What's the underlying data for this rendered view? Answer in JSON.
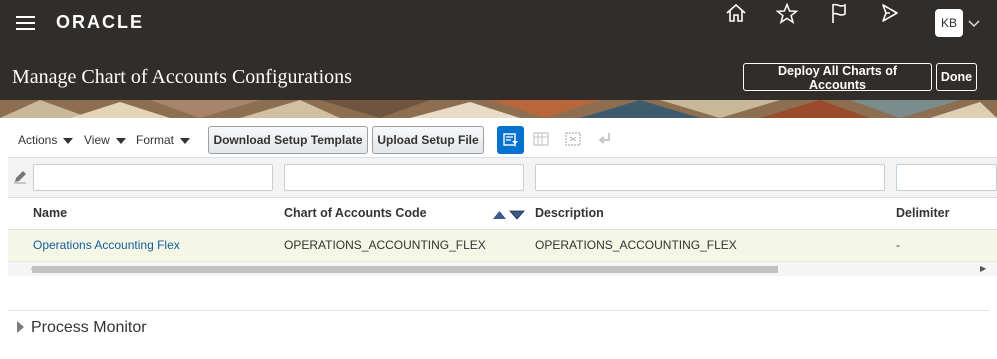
{
  "header": {
    "logo_text": "ORACLE",
    "icons": [
      "home-icon",
      "star-icon",
      "flag-icon",
      "notifications-icon"
    ],
    "user_initials": "KB"
  },
  "page": {
    "title": "Manage Chart of Accounts Configurations",
    "deploy_button": "Deploy All Charts of Accounts",
    "done_button": "Done"
  },
  "toolbar": {
    "menus": [
      "Actions",
      "View",
      "Format"
    ],
    "download_button": "Download Setup Template",
    "upload_button": "Upload Setup File"
  },
  "table": {
    "columns": [
      "Name",
      "Chart of Accounts Code",
      "Description",
      "Delimiter"
    ],
    "rows": [
      {
        "name": "Operations Accounting Flex",
        "code": "OPERATIONS_ACCOUNTING_FLEX",
        "description": "OPERATIONS_ACCOUNTING_FLEX",
        "delimiter": "-"
      }
    ]
  },
  "process_monitor": {
    "label": "Process Monitor"
  },
  "colors": {
    "header_bg": "#312d2a",
    "accent_blue": "#0572ce",
    "link": "#145c9e",
    "selected_row": "#f4f6e6"
  }
}
